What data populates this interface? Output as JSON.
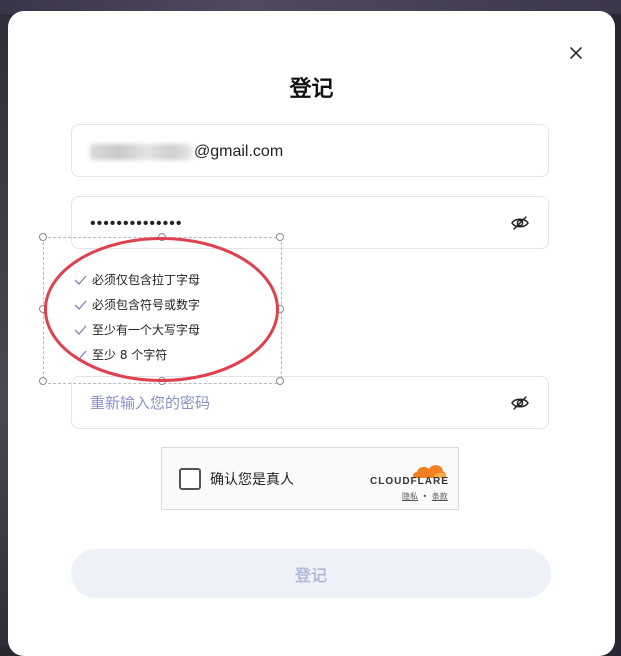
{
  "modal": {
    "title": "登记"
  },
  "form": {
    "email_suffix": "@gmail.com",
    "password_value": "••••••••••••••",
    "confirm_placeholder": "重新输入您的密码",
    "submit_label": "登记"
  },
  "password_rules": [
    {
      "text": "必须仅包含拉丁字母",
      "met": true
    },
    {
      "text": "必须包含符号或数字",
      "met": true
    },
    {
      "text": "至少有一个大写字母",
      "met": true
    },
    {
      "text": "至少 8 个字符",
      "met": true
    }
  ],
  "captcha": {
    "label": "确认您是真人",
    "brand": "CLOUDFLARE",
    "privacy_link": "隐私",
    "separator": "•",
    "terms_link": "条款"
  },
  "icons": {
    "close": "close-icon",
    "eye": "eye-off-icon",
    "check": "check-icon",
    "cloudflare": "cloudflare-logo"
  },
  "colors": {
    "annotation_ellipse": "#e0414f",
    "placeholder": "#8a92c5",
    "submit_disabled_bg": "#eef1f8",
    "cloudflare_orange": "#f38020"
  }
}
